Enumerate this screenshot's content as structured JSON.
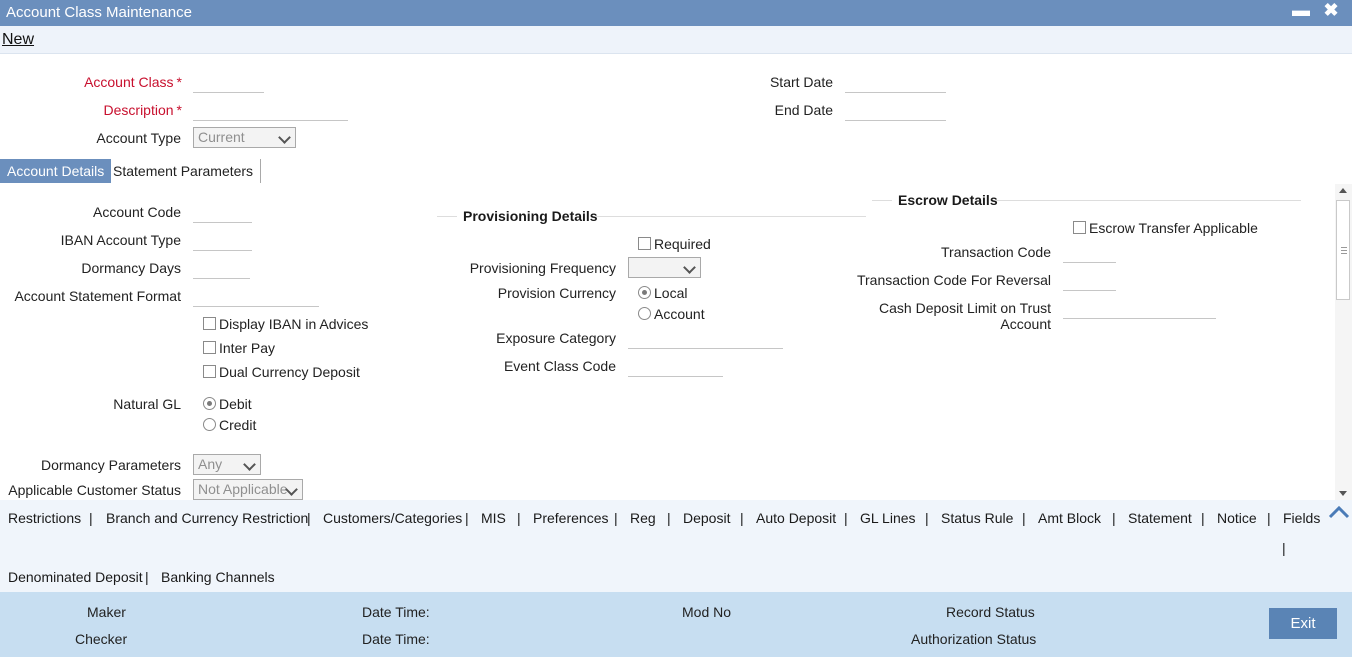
{
  "window": {
    "title": "Account Class Maintenance"
  },
  "menu": {
    "new": "New"
  },
  "header": {
    "account_class": "Account Class",
    "description": "Description",
    "required_marker": "*",
    "account_type": "Account Type",
    "account_type_value": "Current",
    "start_date": "Start Date",
    "end_date": "End Date"
  },
  "tabs": [
    {
      "label": "Account Details",
      "active": true
    },
    {
      "label": "Statement Parameters",
      "active": false
    }
  ],
  "account_details": {
    "account_code": "Account Code",
    "iban_account_type": "IBAN Account Type",
    "dormancy_days": "Dormancy Days",
    "account_statement_format": "Account Statement Format",
    "display_iban": "Display IBAN in Advices",
    "inter_pay": "Inter Pay",
    "dual_currency_deposit": "Dual Currency Deposit",
    "natural_gl": "Natural GL",
    "natural_gl_debit": "Debit",
    "natural_gl_credit": "Credit",
    "dormancy_parameters": "Dormancy Parameters",
    "dormancy_parameters_value": "Any",
    "applicable_customer_status": "Applicable Customer Status",
    "applicable_customer_status_value": "Not Applicable"
  },
  "provisioning": {
    "title": "Provisioning Details",
    "required": "Required",
    "provisioning_frequency": "Provisioning Frequency",
    "provision_currency": "Provision Currency",
    "currency_local": "Local",
    "currency_account": "Account",
    "exposure_category": "Exposure Category",
    "event_class_code": "Event Class Code"
  },
  "escrow": {
    "title": "Escrow Details",
    "transfer_applicable": "Escrow Transfer Applicable",
    "transaction_code": "Transaction Code",
    "transaction_code_reversal": "Transaction Code For Reversal",
    "cash_deposit_limit_line1": "Cash Deposit Limit on Trust",
    "cash_deposit_limit_line2": "Account"
  },
  "subsystems": {
    "row1": [
      "Restrictions",
      "Branch and Currency Restriction",
      "Customers/Categories",
      "MIS",
      "Preferences",
      "Reg",
      "Deposit",
      "Auto Deposit",
      "GL Lines",
      "Status Rule",
      "Amt Block",
      "Statement",
      "Notice",
      "Fields"
    ],
    "row2": [
      "Denominated Deposit",
      "Banking Channels"
    ],
    "separator": "|"
  },
  "footer": {
    "maker": "Maker",
    "checker": "Checker",
    "date_time": "Date Time:",
    "mod_no": "Mod No",
    "record_status": "Record Status",
    "authorization_status": "Authorization Status",
    "exit": "Exit"
  },
  "colors": {
    "titlebar": "#6b8fbd",
    "required_label": "#c8102e",
    "footer": "#c7def1",
    "exit_button": "#5a84b5"
  }
}
